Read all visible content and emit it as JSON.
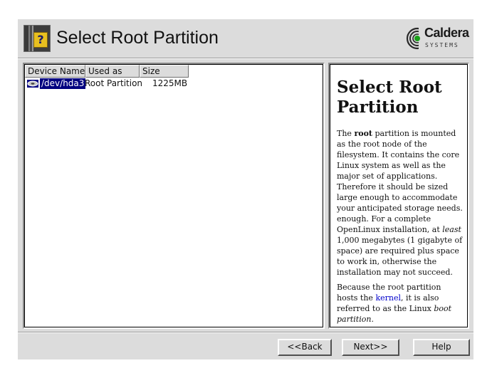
{
  "header": {
    "title": "Select Root Partition",
    "help_icon_glyph": "?",
    "logo": {
      "brand": "Caldera",
      "sub": "SYSTEMS"
    }
  },
  "partition_list": {
    "columns": [
      "Device Name",
      "Used as",
      "Size"
    ],
    "rows": [
      {
        "device": "/dev/hda3",
        "used_as": "Root Partition",
        "size": "1225MB",
        "selected": true,
        "icon": "disk-icon"
      }
    ]
  },
  "help": {
    "heading": "Select Root Partition",
    "p1": {
      "t1": "The ",
      "bold": "root",
      "t2": " partition is mounted as the root node of the filesystem. It contains the core Linux system as well as the major set of applications. Therefore it should be sized large enough to accommodate your anticipated storage needs. enough. For a complete OpenLinux installation, at ",
      "italic": "least",
      "t3": " 1,000 megabytes (1 gigabyte of space) are required plus space to work in, otherwise the installation may not succeed."
    },
    "p2": {
      "t1": "Because the root partition hosts the ",
      "link": "kernel",
      "t2": ", it is also referred to as the Linux ",
      "italic": "boot partition",
      "t3": "."
    }
  },
  "buttons": {
    "back": "<<Back",
    "next": "Next>>",
    "help": "Help"
  },
  "colors": {
    "window_bg": "#dcdcdc",
    "selection": "#000080",
    "link": "#0000cc"
  }
}
